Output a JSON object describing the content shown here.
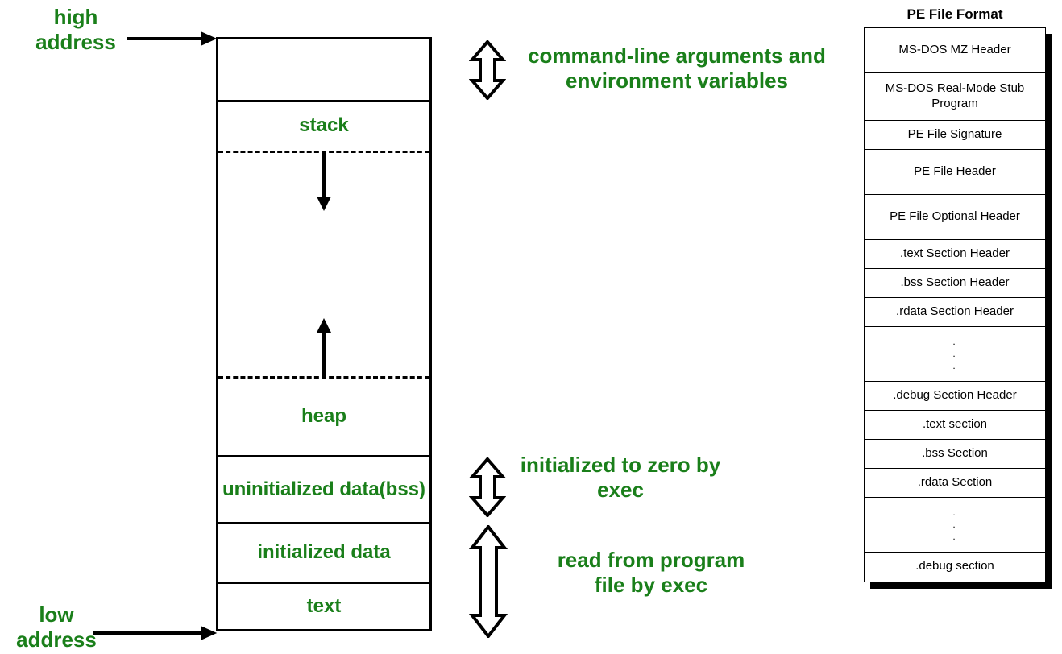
{
  "left": {
    "high_address": "high address",
    "low_address": "low address",
    "segments": {
      "env": "",
      "stack": "stack",
      "heap": "heap",
      "bss": "uninitialized data(bss)",
      "init": "initialized data",
      "text": "text"
    },
    "annotations": {
      "cmd": "command-line arguments and environment variables",
      "zero": "initialized to zero by exec",
      "read": "read from program file by exec"
    }
  },
  "right": {
    "title": "PE File Format",
    "rows": [
      "MS-DOS MZ Header",
      "MS-DOS Real-Mode Stub Program",
      "PE File Signature",
      "PE File Header",
      "PE File Optional Header",
      ".text Section Header",
      ".bss Section Header",
      ".rdata Section Header",
      "...",
      ".debug Section Header",
      ".text section",
      ".bss Section",
      ".rdata Section",
      "...",
      ".debug section"
    ]
  }
}
